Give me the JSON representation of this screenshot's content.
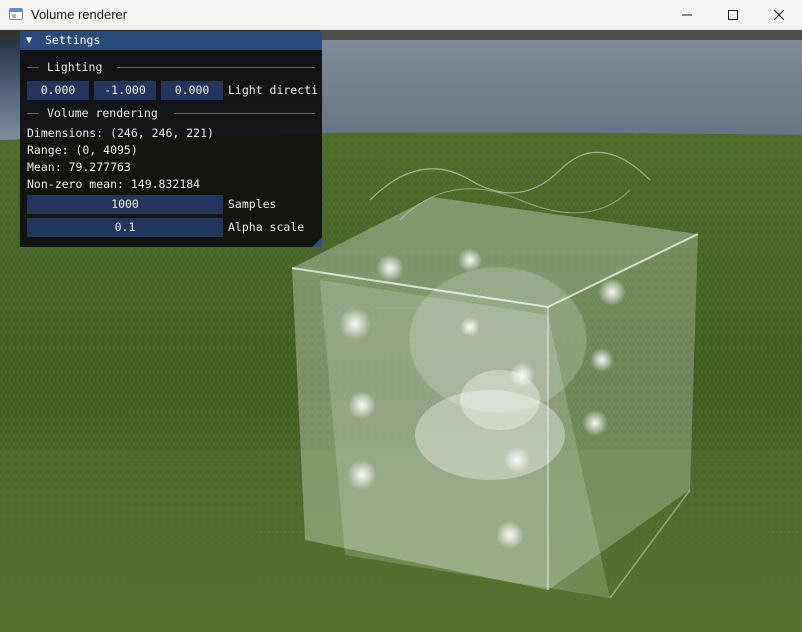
{
  "window": {
    "title": "Volume renderer",
    "controls": {
      "minimize": "minimize-icon",
      "maximize": "maximize-icon",
      "close": "close-icon"
    }
  },
  "panel": {
    "title": "Settings",
    "lighting": {
      "header": "Lighting",
      "x": "0.000",
      "y": "-1.000",
      "z": "0.000",
      "label": "Light directi"
    },
    "volume": {
      "header": "Volume rendering",
      "dimensions": "Dimensions: (246, 246, 221)",
      "range": "Range: (0, 4095)",
      "mean": "Mean: 79.277763",
      "nonzero_mean": "Non-zero mean: 149.832184",
      "samples_value": "1000",
      "samples_label": "Samples",
      "alpha_value": "0.1",
      "alpha_label": "Alpha scale"
    }
  },
  "colors": {
    "panel_header": "#294a7a",
    "input_bg": "#21365a",
    "sky": "#2f3e52",
    "grass": "#4a6e2a"
  }
}
